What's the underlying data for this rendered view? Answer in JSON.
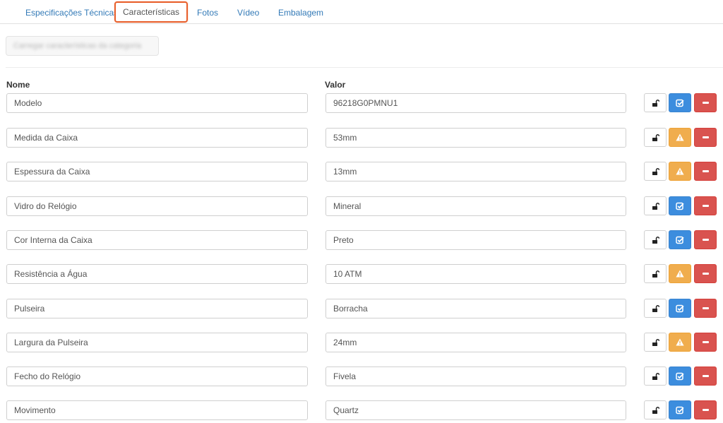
{
  "tabs": [
    {
      "label": "Especificações Técnicas",
      "active": false
    },
    {
      "label": "Características",
      "active": true
    },
    {
      "label": "Fotos",
      "active": false
    },
    {
      "label": "Vídeo",
      "active": false
    },
    {
      "label": "Embalagem",
      "active": false
    }
  ],
  "columns": {
    "name": "Nome",
    "value": "Valor"
  },
  "rows": [
    {
      "name": "Modelo",
      "value": "96218G0PMNU1",
      "status": "check"
    },
    {
      "name": "Medida da Caixa",
      "value": "53mm",
      "status": "warning"
    },
    {
      "name": "Espessura da Caixa",
      "value": "13mm",
      "status": "warning"
    },
    {
      "name": "Vidro do Relógio",
      "value": "Mineral",
      "status": "check"
    },
    {
      "name": "Cor Interna da Caixa",
      "value": "Preto",
      "status": "check"
    },
    {
      "name": "Resistência a Água",
      "value": "10 ATM",
      "status": "warning"
    },
    {
      "name": "Pulseira",
      "value": "Borracha",
      "status": "check"
    },
    {
      "name": "Largura da Pulseira",
      "value": "24mm",
      "status": "warning"
    },
    {
      "name": "Fecho do Relógio",
      "value": "Fivela",
      "status": "check"
    },
    {
      "name": "Movimento",
      "value": "Quartz",
      "status": "check"
    }
  ],
  "icons": {
    "lock": "unlock-icon",
    "check": "check-square-icon",
    "warning": "warning-icon",
    "remove": "minus-icon"
  },
  "colors": {
    "link": "#337ab7",
    "active_outline": "#e8602c",
    "check_button": "#3c8dde",
    "warning_button": "#f0ad4e",
    "remove_button": "#d9534f"
  }
}
